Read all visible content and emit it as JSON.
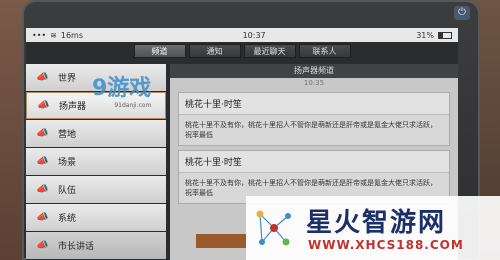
{
  "status": {
    "carrier": "16ms",
    "time": "10:37",
    "battery": "31%",
    "battery_level": 0.31
  },
  "tabs": [
    {
      "label": "频道",
      "active": true
    },
    {
      "label": "通知",
      "active": false
    },
    {
      "label": "最近聊天",
      "active": false
    },
    {
      "label": "联系人",
      "active": false
    }
  ],
  "sidebar": {
    "items": [
      {
        "label": "世界"
      },
      {
        "label": "扬声器"
      },
      {
        "label": "营地"
      },
      {
        "label": "场景"
      },
      {
        "label": "队伍"
      },
      {
        "label": "系统"
      },
      {
        "label": "市长讲话"
      }
    ]
  },
  "panel": {
    "title": "扬声器频道",
    "subtitle": "10:35",
    "messages": [
      {
        "sender": "桃花十里·时笙",
        "text": "桃花十里不及有你，桃花十里招人不管你是萌新还是肝帝或是氪金大佬只求活跃，祝率最低"
      },
      {
        "sender": "桃花十里·时笙",
        "text": "桃花十里不及有你，桃花十里招人不管你是萌新还是肝帝或是氪金大佬只求活跃，祝率最低"
      }
    ]
  },
  "watermark": {
    "top_logo": "9游戏",
    "top_url": "91danji.com",
    "name": "星火智游网",
    "url": "WWW.XHCS188.COM"
  },
  "colors": {
    "accent": "#b08a5a",
    "panel": "#c8c8c8",
    "watermark_blue": "#1c2f68",
    "watermark_red": "#c0322e"
  }
}
